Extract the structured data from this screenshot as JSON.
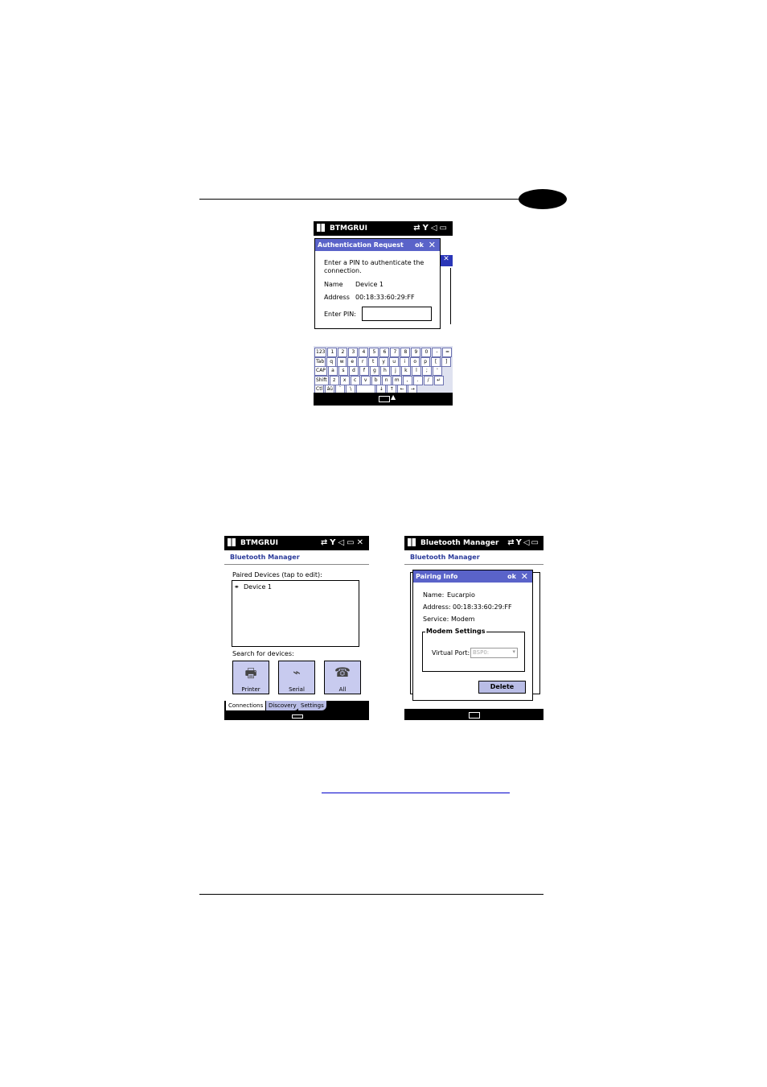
{
  "screen1": {
    "status_title": "BTMGRUI",
    "dialog": {
      "title": "Authentication Request",
      "ok": "ok",
      "close": "✕",
      "prompt_line1": "Enter a PIN to authenticate the",
      "prompt_line2": "connection.",
      "name_label": "Name",
      "name_value": "Device 1",
      "address_label": "Address",
      "address_value": "00:18:33:60:29:FF",
      "pin_label": "Enter PIN:"
    },
    "keyboard": [
      [
        "123",
        "1",
        "2",
        "3",
        "4",
        "5",
        "6",
        "7",
        "8",
        "9",
        "0",
        "-",
        "=",
        "◆"
      ],
      [
        "Tab",
        "q",
        "w",
        "e",
        "r",
        "t",
        "y",
        "u",
        "i",
        "o",
        "p",
        "[",
        "]"
      ],
      [
        "CAP",
        "a",
        "s",
        "d",
        "f",
        "g",
        "h",
        "j",
        "k",
        "l",
        ";",
        "'"
      ],
      [
        "Shift",
        "z",
        "x",
        "c",
        "v",
        "b",
        "n",
        "m",
        ",",
        ".",
        "/",
        "↵"
      ],
      [
        "Ctl",
        "áü",
        "`",
        "\\",
        "",
        "↓",
        "↑",
        "←",
        "→"
      ]
    ]
  },
  "screen2": {
    "status_title": "BTMGRUI",
    "app_title": "Bluetooth Manager",
    "paired_label": "Paired Devices (tap to edit):",
    "device_item": "Device 1",
    "search_label": "Search for devices:",
    "buttons": [
      "Printer",
      "Serial",
      "All"
    ],
    "tabs": [
      "Connections",
      "Discovery",
      "Settings"
    ]
  },
  "screen3": {
    "status_title": "Bluetooth Manager",
    "app_title": "Bluetooth Manager",
    "dialog": {
      "title": "Pairing Info",
      "ok": "ok",
      "close": "✕",
      "name_label": "Name:",
      "name_value": "Eucarpio",
      "address_label": "Address:",
      "address_value": "00:18:33:60:29:FF",
      "service_label": "Service:",
      "service_value": "Modem",
      "group_title": "Modem Settings",
      "port_label": "Virtual Port:",
      "port_value": "BSP0:",
      "delete": "Delete"
    }
  }
}
